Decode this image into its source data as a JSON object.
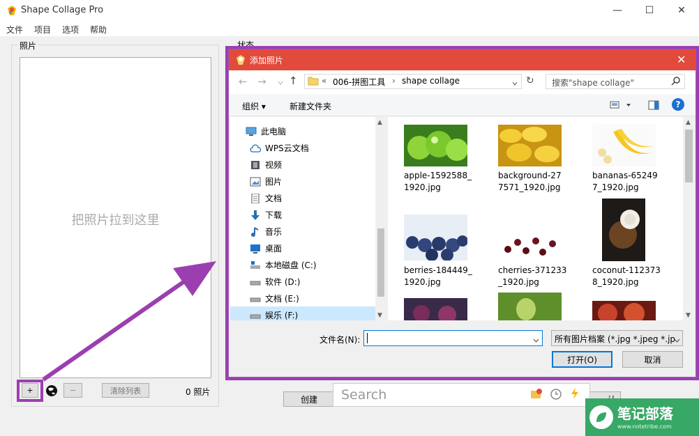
{
  "app": {
    "title": "Shape Collage Pro",
    "menu": [
      "文件",
      "项目",
      "选项",
      "帮助"
    ],
    "window_buttons": [
      "—",
      "☐",
      "✕"
    ]
  },
  "photos_panel": {
    "label": "照片",
    "drop_hint": "把照片拉到这里",
    "add_label": "+",
    "remove_label": "−",
    "clear_label": "清除列表",
    "count": "0 照片"
  },
  "status_panel": {
    "label": "状态"
  },
  "bottom": {
    "create_label": "创建",
    "confirm_partial": "认",
    "search_placeholder": "Search"
  },
  "dialog": {
    "title": "添加照片",
    "close": "✕",
    "nav": {
      "back": "←",
      "forward": "→",
      "up": "↑",
      "refresh": "↻"
    },
    "breadcrumb": [
      "«",
      "006-拼图工具",
      "›",
      "shape collage"
    ],
    "search_placeholder": "搜索\"shape collage\"",
    "toolbar": {
      "organize": "组织 ▾",
      "new_folder": "新建文件夹",
      "help": "?"
    },
    "nav_items": [
      {
        "label": "此电脑",
        "icon": "computer-icon"
      },
      {
        "label": "WPS云文档",
        "icon": "cloud-icon"
      },
      {
        "label": "视频",
        "icon": "video-icon"
      },
      {
        "label": "图片",
        "icon": "picture-icon"
      },
      {
        "label": "文档",
        "icon": "document-icon"
      },
      {
        "label": "下载",
        "icon": "download-icon"
      },
      {
        "label": "音乐",
        "icon": "music-icon"
      },
      {
        "label": "桌面",
        "icon": "desktop-icon"
      },
      {
        "label": "本地磁盘 (C:)",
        "icon": "drive-icon"
      },
      {
        "label": "软件 (D:)",
        "icon": "drive-icon"
      },
      {
        "label": "文档 (E:)",
        "icon": "drive-icon"
      },
      {
        "label": "娱乐 (F:)",
        "icon": "drive-icon"
      }
    ],
    "files": [
      {
        "line1": "apple-1592588_",
        "line2": "1920.jpg"
      },
      {
        "line1": "background-27",
        "line2": "7571_1920.jpg"
      },
      {
        "line1": "bananas-65249",
        "line2": "7_1920.jpg"
      },
      {
        "line1": "berries-184449_",
        "line2": "1920.jpg"
      },
      {
        "line1": "cherries-371233",
        "line2": "_1920.jpg"
      },
      {
        "line1": "coconut-112373",
        "line2": "8_1920.jpg"
      }
    ],
    "filename_label": "文件名(N):",
    "filename_value": "",
    "filetype": "所有图片档案 (*.jpg *.jpeg *.jp",
    "open_label": "打开(O)",
    "cancel_label": "取消"
  },
  "watermark": {
    "text": "笔记部落",
    "url": "www.notetribe.com"
  },
  "colors": {
    "dialog_title": "#e24a3b",
    "annotation": "#9b3fb0",
    "watermark": "#37a866"
  }
}
